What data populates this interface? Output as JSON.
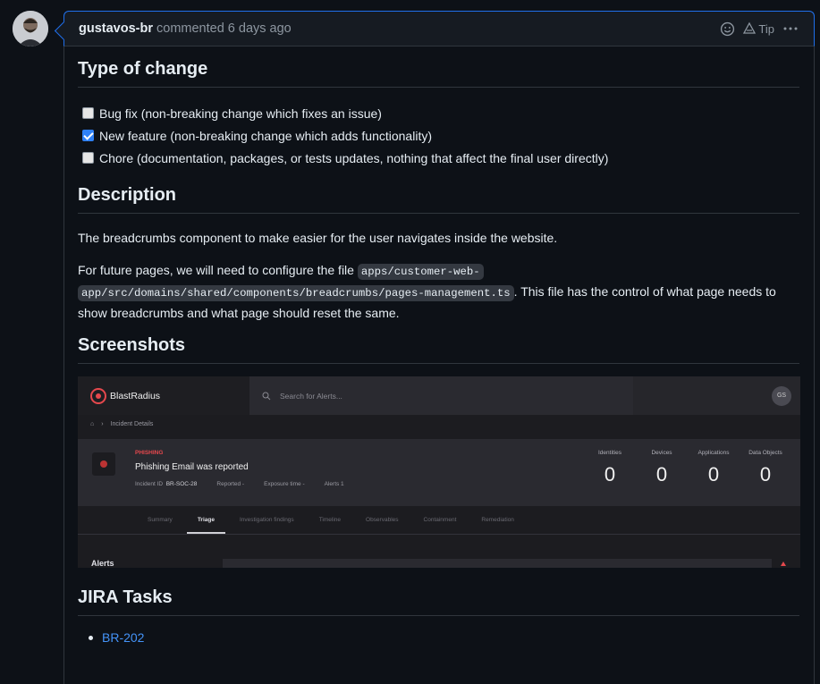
{
  "comment": {
    "author": "gustavos-br",
    "meta": "commented 6 days ago",
    "actions": {
      "tip_label": "Tip"
    }
  },
  "sections": {
    "type_of_change": {
      "heading": "Type of change",
      "items": [
        {
          "label": "Bug fix (non-breaking change which fixes an issue)",
          "checked": false
        },
        {
          "label": "New feature (non-breaking change which adds functionality)",
          "checked": true
        },
        {
          "label": "Chore (documentation, packages, or tests updates, nothing that affect the final user directly)",
          "checked": false
        }
      ]
    },
    "description": {
      "heading": "Description",
      "para1": "The breadcrumbs component to make easier for the user navigates inside the website.",
      "para2_before": "For future pages, we will need to configure the file ",
      "para2_code_line1": "apps/customer-web-",
      "para2_code_line2": "app/src/domains/shared/components/breadcrumbs/pages-management.ts",
      "para2_after": ". This file has the control of what page needs to",
      "para2_line3": "show breadcrumbs and what page should reset the same."
    },
    "screenshots": {
      "heading": "Screenshots",
      "app": {
        "brand": "BlastRadius",
        "search_placeholder": "Search for Alerts...",
        "user_initials": "GS",
        "breadcrumb": "Incident Details",
        "incident_tag": "PHISHING",
        "incident_title": "Phishing Email was reported",
        "incident_id_label": "Incident ID",
        "incident_id": "BR-SOC-28",
        "reported": "Reported  -",
        "exposure": "Exposure time  -",
        "alerts_meta": "Alerts  1",
        "stats": [
          {
            "label": "Identities",
            "value": "0"
          },
          {
            "label": "Devices",
            "value": "0"
          },
          {
            "label": "Applications",
            "value": "0"
          },
          {
            "label": "Data Objects",
            "value": "0"
          }
        ],
        "tabs": [
          "Summary",
          "Triage",
          "Investigation findings",
          "Timeline",
          "Observables",
          "Containment",
          "Remediation"
        ],
        "active_tab": "Triage",
        "alerts_heading": "Alerts"
      }
    },
    "jira": {
      "heading": "JIRA Tasks",
      "links": [
        "BR-202"
      ]
    }
  },
  "colors": {
    "accent": "#4493f8",
    "check": "#2f81f7",
    "bg": "#0d1117",
    "header_bg": "#161b22"
  }
}
